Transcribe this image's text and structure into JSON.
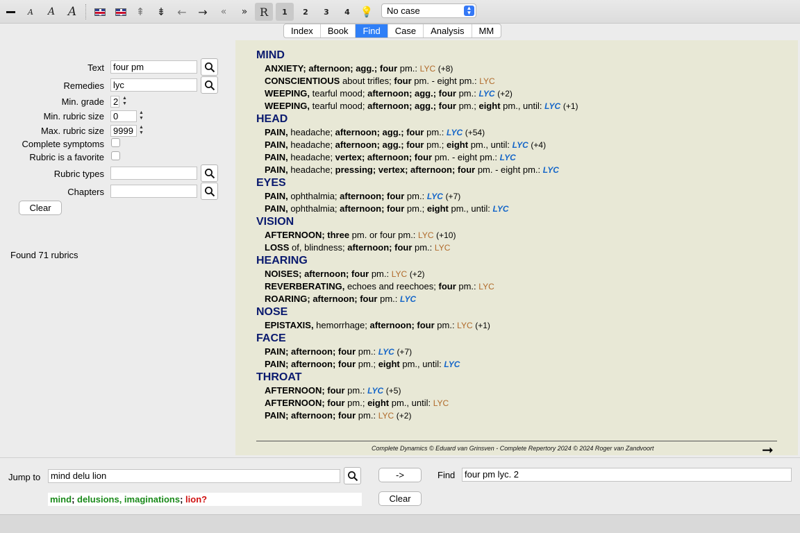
{
  "toolbar": {
    "font_glyph": "A",
    "r_label": "R",
    "grade_buttons": [
      "1",
      "2",
      "3",
      "4"
    ],
    "case_select": "No case"
  },
  "tabs": [
    "Index",
    "Book",
    "Find",
    "Case",
    "Analysis",
    "MM"
  ],
  "find_panel": {
    "text_label": "Text",
    "text_value": "four pm",
    "remedies_label": "Remedies",
    "remedies_value": "lyc",
    "min_grade_label": "Min. grade",
    "min_grade_value": "2",
    "min_rubric_label": "Min. rubric size",
    "min_rubric_value": "0",
    "max_rubric_label": "Max. rubric size",
    "max_rubric_value": "9999",
    "complete_label": "Complete symptoms",
    "favorite_label": "Rubric is a favorite",
    "rubric_types_label": "Rubric types",
    "chapters_label": "Chapters",
    "clear_label": "Clear",
    "found": "Found 71 rubrics"
  },
  "results": {
    "chapters": [
      {
        "name": "MIND",
        "rubrics": [
          {
            "b": "ANXIETY; afternoon; agg.; four",
            "t": " pm.: ",
            "rem": "LYC",
            "g": 2,
            "cnt": "(+8)"
          },
          {
            "b": "CONSCIENTIOUS",
            "t": " about trifles; ",
            "b2": "four",
            "t2": " pm. - eight pm.: ",
            "rem": "LYC",
            "g": 2,
            "cnt": ""
          },
          {
            "b": "WEEPING,",
            "t": " tearful mood; ",
            "b2": "afternoon; agg.; four",
            "t2": " pm.: ",
            "rem": "LYC",
            "g": 3,
            "cnt": "(+2)"
          },
          {
            "b": "WEEPING,",
            "t": " tearful mood; ",
            "b2": "afternoon; agg.; four",
            "t2": " pm.; ",
            "b3": "eight",
            "t3": " pm., until: ",
            "rem": "LYC",
            "g": 3,
            "cnt": "(+1)"
          }
        ]
      },
      {
        "name": "HEAD",
        "rubrics": [
          {
            "b": "PAIN,",
            "t": " headache; ",
            "b2": "afternoon; agg.; four",
            "t2": " pm.: ",
            "rem": "LYC",
            "g": 3,
            "cnt": "(+54)"
          },
          {
            "b": "PAIN,",
            "t": " headache; ",
            "b2": "afternoon; agg.; four",
            "t2": " pm.; ",
            "b3": "eight",
            "t3": " pm., until: ",
            "rem": "LYC",
            "g": 3,
            "cnt": "(+4)"
          },
          {
            "b": "PAIN,",
            "t": " headache; ",
            "b2": "vertex; afternoon; four",
            "t2": " pm. - eight pm.: ",
            "rem": "LYC",
            "g": 3,
            "cnt": ""
          },
          {
            "b": "PAIN,",
            "t": " headache; ",
            "b2": "pressing; vertex; afternoon; four",
            "t2": " pm. - eight pm.: ",
            "rem": "LYC",
            "g": 3,
            "cnt": ""
          }
        ]
      },
      {
        "name": "EYES",
        "rubrics": [
          {
            "b": "PAIN,",
            "t": " ophthalmia; ",
            "b2": "afternoon; four",
            "t2": " pm.: ",
            "rem": "LYC",
            "g": 3,
            "cnt": "(+7)"
          },
          {
            "b": "PAIN,",
            "t": " ophthalmia; ",
            "b2": "afternoon; four",
            "t2": " pm.; ",
            "b3": "eight",
            "t3": " pm., until: ",
            "rem": "LYC",
            "g": 3,
            "cnt": ""
          }
        ]
      },
      {
        "name": "VISION",
        "rubrics": [
          {
            "b": "AFTERNOON; three",
            "t": " pm. or four pm.: ",
            "rem": "LYC",
            "g": 2,
            "cnt": "(+10)"
          },
          {
            "b": "LOSS",
            "t": " of, blindness; ",
            "b2": "afternoon; four",
            "t2": " pm.: ",
            "rem": "LYC",
            "g": 2,
            "cnt": ""
          }
        ]
      },
      {
        "name": "HEARING",
        "rubrics": [
          {
            "b": "NOISES; afternoon; four",
            "t": " pm.: ",
            "rem": "LYC",
            "g": 2,
            "cnt": "(+2)"
          },
          {
            "b": "REVERBERATING,",
            "t": " echoes and reechoes; ",
            "b2": "four",
            "t2": " pm.: ",
            "rem": "LYC",
            "g": 2,
            "cnt": ""
          },
          {
            "b": "ROARING; afternoon; four",
            "t": " pm.: ",
            "rem": "LYC",
            "g": 3,
            "cnt": ""
          }
        ]
      },
      {
        "name": "NOSE",
        "rubrics": [
          {
            "b": "EPISTAXIS,",
            "t": " hemorrhage; ",
            "b2": "afternoon; four",
            "t2": " pm.: ",
            "rem": "LYC",
            "g": 2,
            "cnt": "(+1)"
          }
        ]
      },
      {
        "name": "FACE",
        "rubrics": [
          {
            "b": "PAIN; afternoon; four",
            "t": " pm.: ",
            "rem": "LYC",
            "g": 3,
            "cnt": "(+7)"
          },
          {
            "b": "PAIN; afternoon; four",
            "t": " pm.; ",
            "b2": "eight",
            "t2": " pm., until: ",
            "rem": "LYC",
            "g": 3,
            "cnt": ""
          }
        ]
      },
      {
        "name": "THROAT",
        "rubrics": [
          {
            "b": "AFTERNOON; four",
            "t": " pm.: ",
            "rem": "LYC",
            "g": 3,
            "cnt": "(+5)"
          },
          {
            "b": "AFTERNOON; four",
            "t": " pm.; ",
            "b2": "eight",
            "t2": " pm., until: ",
            "rem": "LYC",
            "g": 2,
            "cnt": ""
          },
          {
            "b": "PAIN; afternoon; four",
            "t": " pm.: ",
            "rem": "LYC",
            "g": 2,
            "cnt": "(+2)"
          }
        ]
      }
    ],
    "footer": "Complete Dynamics © Eduard van Grinsven  -  Complete Repertory 2024 © 2024 Roger van Zandvoort"
  },
  "bottom": {
    "jump_label": "Jump to",
    "jump_value": "mind delu lion",
    "go_label": "->",
    "find_label": "Find",
    "find_value": "four pm lyc. 2",
    "clear_label": "Clear",
    "hint": [
      {
        "text": "mind",
        "c": "g"
      },
      {
        "text": "; ",
        "c": ""
      },
      {
        "text": "delusions, imaginations",
        "c": "g"
      },
      {
        "text": "; ",
        "c": ""
      },
      {
        "text": "lion?",
        "c": "r"
      }
    ]
  }
}
